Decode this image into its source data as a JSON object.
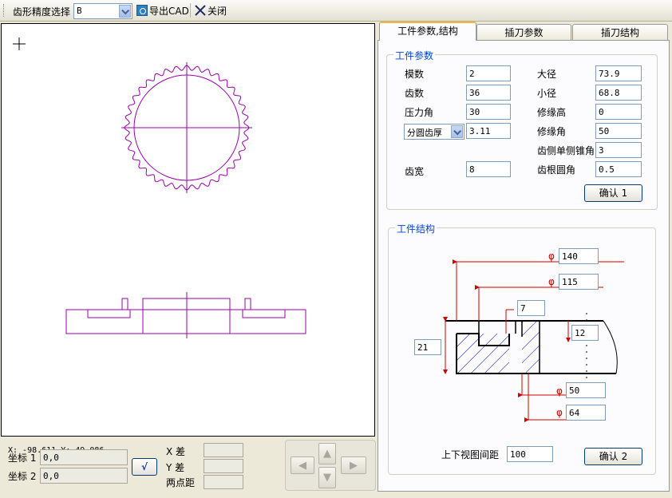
{
  "toolbar": {
    "precision_label": "齿形精度选择",
    "precision_value": "B",
    "export_label": "导出CAD",
    "close_label": "关闭"
  },
  "canvas": {
    "cursor_readout": "X: -98.611  Y: 49.086"
  },
  "bottom": {
    "coord1_label": "坐标 1",
    "coord1_value": "0,0",
    "coord2_label": "坐标 2",
    "coord2_value": "0,0",
    "confirm_symbol": "√",
    "xdiff_label": "X 差",
    "ydiff_label": "Y 差",
    "dist_label": "两点距",
    "xdiff_value": "",
    "ydiff_value": "",
    "dist_value": ""
  },
  "tabs": [
    {
      "label": "工件参数,结构"
    },
    {
      "label": "插刀参数"
    },
    {
      "label": "插刀结构"
    }
  ],
  "params": {
    "group_title": "工件参数",
    "module_label": "模数",
    "module_value": "2",
    "teeth_label": "齿数",
    "teeth_value": "36",
    "pressure_label": "压力角",
    "pressure_value": "30",
    "thickness_select": "分圆齿厚",
    "thickness_value": "3.11",
    "width_label": "齿宽",
    "width_value": "8",
    "major_label": "大径",
    "major_value": "73.9",
    "minor_label": "小径",
    "minor_value": "68.8",
    "mod_height_label": "修缘高",
    "mod_height_value": "0",
    "mod_angle_label": "修缘角",
    "mod_angle_value": "50",
    "taper_label": "齿侧单侧锥角",
    "taper_value": "3",
    "root_label": "齿根圆角",
    "root_value": "0.5",
    "confirm1": "确认 1"
  },
  "structure": {
    "group_title": "工件结构",
    "phi": "φ",
    "d140": "140",
    "d115": "115",
    "d7": "7",
    "d12": "12",
    "d21": "21",
    "d50": "50",
    "d64": "64",
    "gap_label": "上下视图间距",
    "gap_value": "100",
    "confirm2": "确认 2"
  },
  "colors": {
    "drawing": "#9900aa",
    "dimension": "#cc0000",
    "accent_title": "#0046d5",
    "tab_highlight": "#f6b53e"
  }
}
